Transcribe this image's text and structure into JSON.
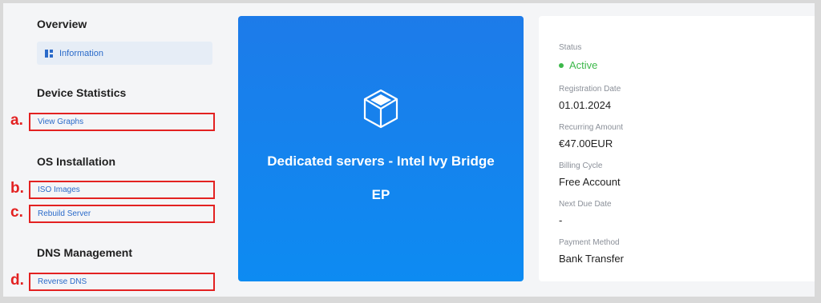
{
  "sidebar": {
    "overview": {
      "title": "Overview",
      "information_label": "Information"
    },
    "device_statistics": {
      "title": "Device Statistics",
      "view_graphs_label": "View Graphs",
      "marker": "a."
    },
    "os_installation": {
      "title": "OS Installation",
      "iso_images_label": "ISO Images",
      "iso_marker": "b.",
      "rebuild_label": "Rebuild Server",
      "rebuild_marker": "c."
    },
    "dns_management": {
      "title": "DNS Management",
      "reverse_dns_label": "Reverse DNS",
      "marker": "d."
    }
  },
  "product_card": {
    "name_line1": "Dedicated servers - Intel Ivy Bridge",
    "name_line2": "EP",
    "icon": "cube-icon"
  },
  "details": {
    "status_label": "Status",
    "status_value": "Active",
    "registration_label": "Registration Date",
    "registration_value": "01.01.2024",
    "recurring_label": "Recurring Amount",
    "recurring_value": "€47.00EUR",
    "billing_label": "Billing Cycle",
    "billing_value": "Free Account",
    "next_due_label": "Next Due Date",
    "next_due_value": "-",
    "payment_label": "Payment Method",
    "payment_value": "Bank Transfer"
  },
  "colors": {
    "accent": "#2a6ac9",
    "highlight": "#e32121",
    "card_gradient_top": "#1d7be9",
    "card_gradient_bottom": "#0d8bf2",
    "status_active": "#3cb84a"
  }
}
